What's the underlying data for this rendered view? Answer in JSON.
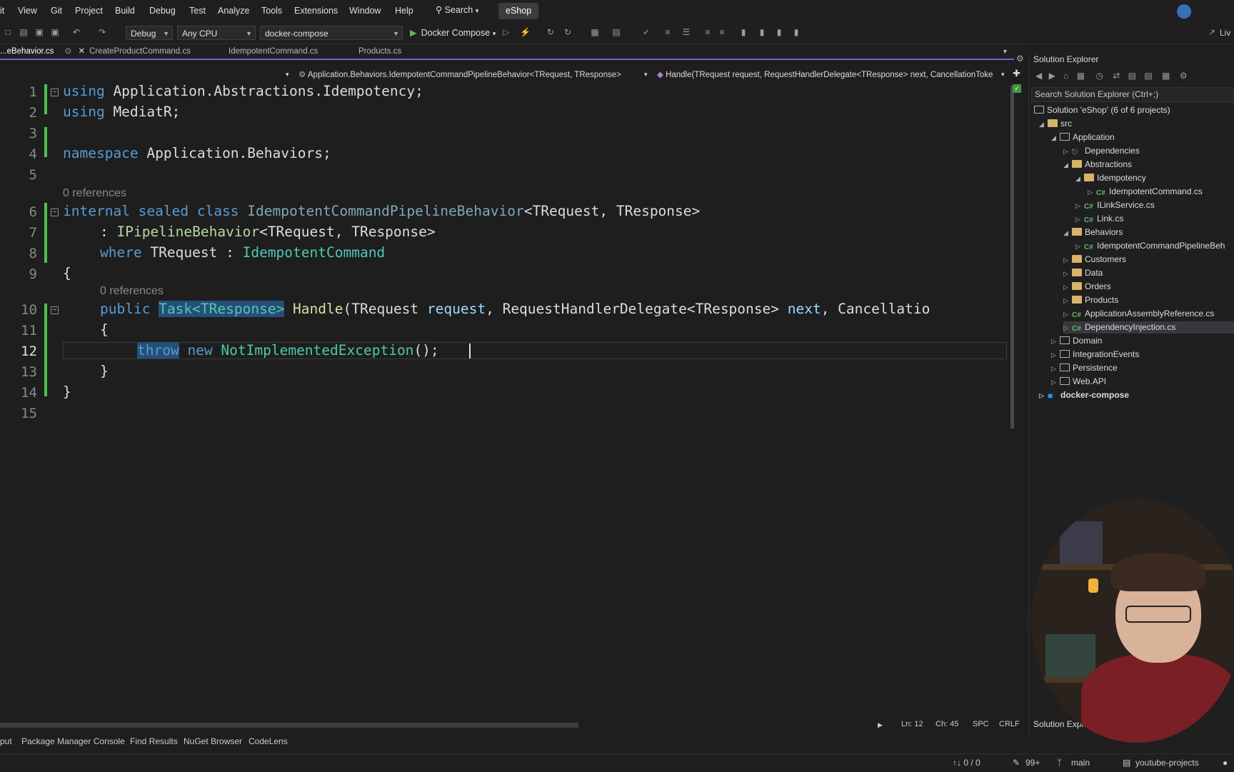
{
  "menu": [
    "it",
    "View",
    "Git",
    "Project",
    "Build",
    "Debug",
    "Test",
    "Analyze",
    "Tools",
    "Extensions",
    "Window",
    "Help"
  ],
  "search_label": "Search",
  "solution_name": "eShop",
  "toolbar": {
    "configuration": "Debug",
    "platform": "Any CPU",
    "startup_project": "docker-compose",
    "run_label": "Docker Compose",
    "live_label": "Liv"
  },
  "tabs": [
    {
      "label": "...eBehavior.cs",
      "active": true
    },
    {
      "label": "CreateProductCommand.cs",
      "active": false
    },
    {
      "label": "IdempotentCommand.cs",
      "active": false
    },
    {
      "label": "Products.cs",
      "active": false
    }
  ],
  "navbar": {
    "type_path": "Application.Behaviors.IdempotentCommandPipelineBehavior<TRequest, TResponse>",
    "member": "Handle(TRequest request, RequestHandlerDelegate<TResponse> next, CancellationToke"
  },
  "editor": {
    "line_numbers": [
      "1",
      "2",
      "3",
      "4",
      "5",
      "6",
      "7",
      "8",
      "9",
      "10",
      "11",
      "12",
      "13",
      "14",
      "15"
    ],
    "current_line": "12",
    "codelens": [
      "0 references",
      "0 references"
    ],
    "code": {
      "l1_kw": "using",
      "l1_rest": " Application.Abstractions.Idempotency;",
      "l2_kw": "using",
      "l2_rest": " MediatR;",
      "l4_kw": "namespace",
      "l4_rest": " Application.Behaviors;",
      "l6_kw": "internal sealed class",
      "l6_name": " IdempotentCommandPipelineBehavior",
      "l6_rest": "<TRequest, TResponse>",
      "l7_pre": ": ",
      "l7_iface": "IPipelineBehavior",
      "l7_rest": "<TRequest, TResponse>",
      "l8_kw": "where",
      "l8_rest": " TRequest : ",
      "l8_type": "IdempotentCommand",
      "l9": "{",
      "l10_kw": "public",
      "l10_task": "Task<TResponse>",
      "l10_fn": " Handle",
      "l10_rest": "(TRequest ",
      "l10_p1": "request",
      "l10_mid": ", RequestHandlerDelegate<TResponse> ",
      "l10_p2": "next",
      "l10_end": ", Cancellatio",
      "l11": "{",
      "l12_kw": "throw",
      "l12_new": " new ",
      "l12_type": "NotImplementedException",
      "l12_rest": "();",
      "l13": "}",
      "l14": "}"
    }
  },
  "status": {
    "ln": "Ln: 12",
    "ch": "Ch: 45",
    "spc": "SPC",
    "crlf": "CRLF"
  },
  "bottom_tabs": [
    "put",
    "Package Manager Console",
    "Find Results",
    "NuGet Browser",
    "CodeLens"
  ],
  "statusbar": {
    "sync": "↑↓ 0 / 0",
    "changes": "99+",
    "branch": "main",
    "repo": "youtube-projects"
  },
  "solution_explorer": {
    "title": "Solution Explorer",
    "search_placeholder": "Search Solution Explorer (Ctrl+;)",
    "tab_label": "Solution Explo",
    "items": [
      {
        "label": "Solution 'eShop' (6 of 6 projects)"
      },
      {
        "label": "src"
      },
      {
        "label": "Application"
      },
      {
        "label": "Dependencies"
      },
      {
        "label": "Abstractions"
      },
      {
        "label": "Idempotency"
      },
      {
        "label": "IdempotentCommand.cs"
      },
      {
        "label": "ILinkService.cs"
      },
      {
        "label": "Link.cs"
      },
      {
        "label": "Behaviors"
      },
      {
        "label": "IdempotentCommandPipelineBeh"
      },
      {
        "label": "Customers"
      },
      {
        "label": "Data"
      },
      {
        "label": "Orders"
      },
      {
        "label": "Products"
      },
      {
        "label": "ApplicationAssemblyReference.cs"
      },
      {
        "label": "DependencyInjection.cs"
      },
      {
        "label": "Domain"
      },
      {
        "label": "IntegrationEvents"
      },
      {
        "label": "Persistence"
      },
      {
        "label": "Web.API"
      },
      {
        "label": "docker-compose"
      }
    ]
  }
}
